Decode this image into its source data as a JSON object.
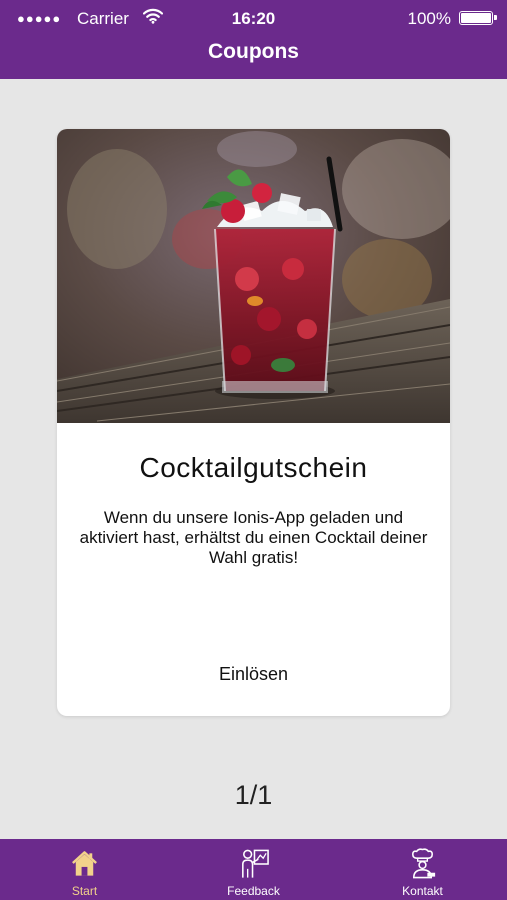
{
  "status_bar": {
    "signal_dots": "●●●●●",
    "carrier": "Carrier",
    "wifi_icon": "wifi-icon",
    "time": "16:20",
    "battery_percent": "100%",
    "battery_icon": "battery-icon"
  },
  "header": {
    "title": "Coupons"
  },
  "coupon": {
    "image_subject": "red raspberry cocktail with crushed ice, mint and straw on a wooden table",
    "title": "Cocktailgutschein",
    "description": "Wenn du unsere Ionis-App geladen und aktiviert hast, erhältst du einen Cocktail deiner Wahl gratis!",
    "redeem_label": "Einlösen"
  },
  "pager": {
    "text": "1/1"
  },
  "tabbar": {
    "tabs": [
      {
        "label": "Start",
        "icon": "home-icon",
        "active": true
      },
      {
        "label": "Feedback",
        "icon": "presenter-icon",
        "active": false
      },
      {
        "label": "Kontakt",
        "icon": "chef-icon",
        "active": false
      }
    ]
  },
  "colors": {
    "brand_purple": "#6b2a8c",
    "active_tab": "#f2d28b",
    "background": "#e6e6e6",
    "card": "#ffffff"
  }
}
